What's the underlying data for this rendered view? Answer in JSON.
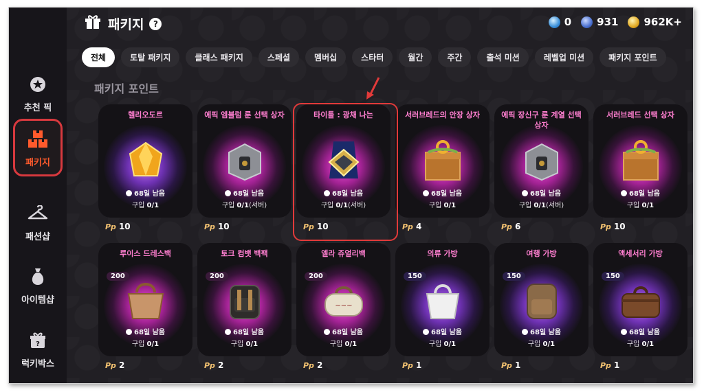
{
  "sidebar": {
    "items": [
      {
        "label": "추천 픽",
        "icon": "star-badge-icon"
      },
      {
        "label": "패키지",
        "icon": "package-boxes-icon",
        "active": true
      },
      {
        "label": "패션샵",
        "icon": "hanger-icon"
      },
      {
        "label": "아이템샵",
        "icon": "money-bag-icon"
      },
      {
        "label": "럭키박스",
        "icon": "lucky-gift-icon"
      }
    ]
  },
  "header": {
    "title": "패키지",
    "help": "?"
  },
  "currency": [
    {
      "value": "0",
      "icon": "blue-gem-coin-icon"
    },
    {
      "value": "931",
      "icon": "blue-coin-icon"
    },
    {
      "value": "962K+",
      "icon": "gold-coin-icon"
    }
  ],
  "tabs": [
    "전체",
    "토탈 패키지",
    "클래스 패키지",
    "스페셜",
    "멤버십",
    "스타터",
    "월간",
    "주간",
    "출석 미션",
    "레벨업 미션",
    "패키지 포인트"
  ],
  "active_tab": "전체",
  "section_title": "패키지 포인트",
  "colors": {
    "accent_red": "#e23a3a",
    "name_pink": "#ff7fd0",
    "active_sidebar": "#ff5a2c"
  },
  "cards": [
    {
      "name": "헬리오도르",
      "remain": "68일 남음",
      "purchase_label": "구입",
      "purchase_value": "0/1",
      "purchase_suffix": "",
      "price": "10",
      "glow": "purple",
      "art": "gem-icon"
    },
    {
      "name": "에픽 엠블럼 룬 선택 상자",
      "remain": "68일 남음",
      "purchase_label": "구입",
      "purchase_value": "0/1",
      "purchase_suffix": "(서버)",
      "price": "10",
      "glow": "pink",
      "art": "steel-chest-icon"
    },
    {
      "name": "타이틀 : 광채 나는",
      "remain": "68일 남음",
      "purchase_label": "구입",
      "purchase_value": "0/1",
      "purchase_suffix": "(서버)",
      "price": "10",
      "glow": "pink",
      "art": "title-emblem-icon",
      "highlighted": true
    },
    {
      "name": "서러브레드의 안장 상자",
      "remain": "68일 남음",
      "purchase_label": "구입",
      "purchase_value": "0/1",
      "purchase_suffix": "",
      "price": "4",
      "glow": "pink",
      "art": "wooden-chest-icon"
    },
    {
      "name": "에픽 장신구 룬 계열 선택 상자",
      "remain": "68일 남음",
      "purchase_label": "구입",
      "purchase_value": "0/1",
      "purchase_suffix": "(서버)",
      "price": "6",
      "glow": "pink",
      "art": "steel-chest-icon"
    },
    {
      "name": "서러브레드 선택 상자",
      "remain": "68일 남음",
      "purchase_label": "구입",
      "purchase_value": "0/1",
      "purchase_suffix": "",
      "price": "10",
      "glow": "pink",
      "art": "wooden-chest-icon"
    },
    {
      "name": "루이스 드레스백",
      "badge": "200",
      "remain": "68일 남음",
      "purchase_label": "구입",
      "purchase_value": "0/1",
      "purchase_suffix": "",
      "price": "2",
      "glow": "pink",
      "art": "handbag-icon"
    },
    {
      "name": "토크 컴뱃 백팩",
      "badge": "200",
      "remain": "68일 남음",
      "purchase_label": "구입",
      "purchase_value": "0/1",
      "purchase_suffix": "",
      "price": "2",
      "glow": "pink",
      "art": "backpack-icon"
    },
    {
      "name": "엘라 쥬얼리백",
      "badge": "200",
      "remain": "68일 남음",
      "purchase_label": "구입",
      "purchase_value": "0/1",
      "purchase_suffix": "",
      "price": "2",
      "glow": "pink",
      "art": "duffel-bag-icon"
    },
    {
      "name": "의류 가방",
      "badge": "150",
      "remain": "68일 남음",
      "purchase_label": "구입",
      "purchase_value": "0/1",
      "purchase_suffix": "",
      "price": "1",
      "glow": "purple",
      "art": "tote-bag-icon"
    },
    {
      "name": "여행 가방",
      "badge": "150",
      "remain": "68일 남음",
      "purchase_label": "구입",
      "purchase_value": "0/1",
      "purchase_suffix": "",
      "price": "1",
      "glow": "purple",
      "art": "travel-backpack-icon"
    },
    {
      "name": "액세서리 가방",
      "badge": "150",
      "remain": "68일 남음",
      "purchase_label": "구입",
      "purchase_value": "0/1",
      "purchase_suffix": "",
      "price": "1",
      "glow": "purple",
      "art": "doctor-bag-icon"
    }
  ]
}
